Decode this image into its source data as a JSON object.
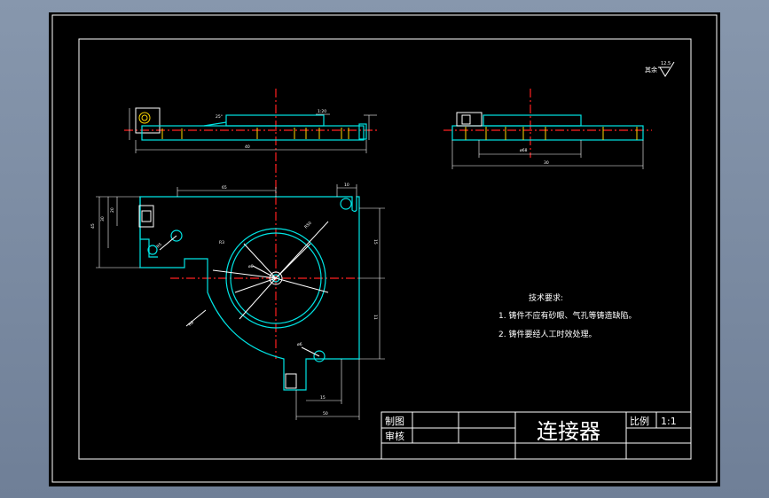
{
  "drawing": {
    "part_name": "连接器",
    "scale_label": "比例",
    "scale_value": "1:1",
    "drawn_by_label": "制图",
    "checked_by_label": "审核"
  },
  "roughness": {
    "label": "其余",
    "value": "12.5"
  },
  "technical_requirements": {
    "title": "技术要求:",
    "items": [
      "1. 铸件不应有砂眼、气孔等铸造缺陷。",
      "2. 铸件要经人工时效处理。"
    ]
  },
  "dimensions": {
    "top_view_width": "40",
    "side_view_width": "30",
    "side_view_inner": "ø68",
    "plan_top": "65",
    "plan_right_upper": "15",
    "plan_right_lower": "11",
    "plan_bottom": "50",
    "plan_bottom_small": "15",
    "slot_top": "10",
    "left_height": "45",
    "left_inner_a": "30",
    "left_inner_b": "20",
    "radius_small": "R5",
    "radius_large": "R50",
    "center_dia": "ø8",
    "hole_dia": "ø6",
    "radius_c": "R8",
    "diag_small": "R3",
    "angle_note": "1:20",
    "top_callout": "25°"
  },
  "colors": {
    "frame": "#ffffff",
    "outline": "#00e5e5",
    "hidden": "#ffd900",
    "center": "#ff2020",
    "hatch": "#33ff66",
    "paper": "#000000",
    "background": "#7f8ea5"
  }
}
